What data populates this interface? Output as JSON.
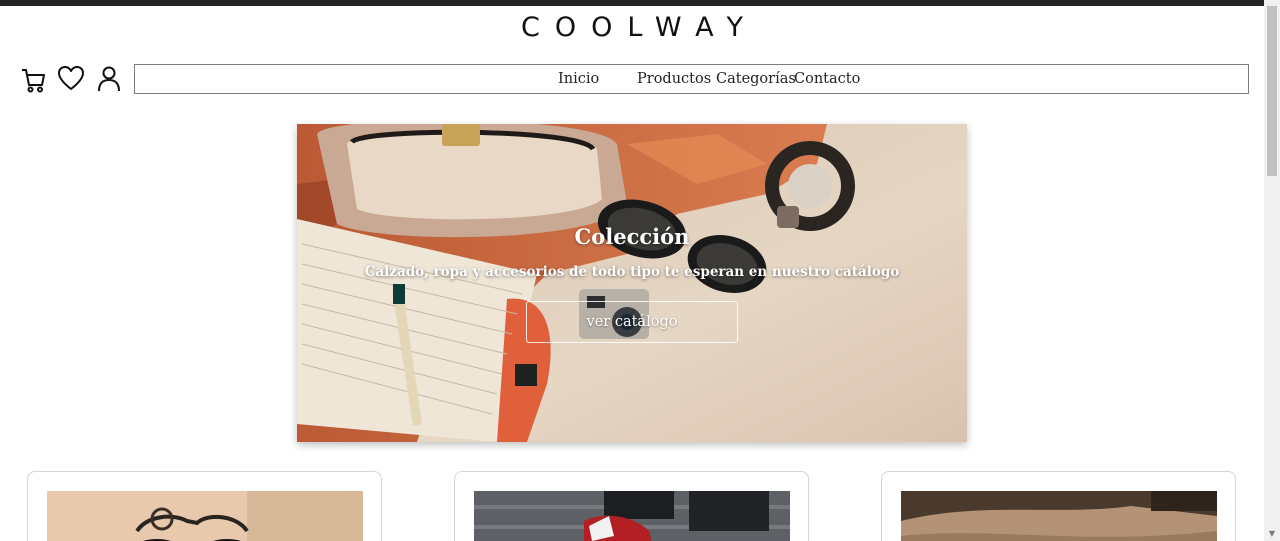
{
  "brand": {
    "name": "COOLWAY"
  },
  "header": {
    "icons": [
      "cart-icon",
      "heart-icon",
      "user-icon"
    ]
  },
  "nav": {
    "items": [
      {
        "label": "Inicio"
      },
      {
        "label": "Productos"
      },
      {
        "label": "Categorías"
      },
      {
        "label": "Contacto"
      }
    ]
  },
  "hero": {
    "title": "Colección",
    "subtitle": "Calzado, ropa y accesorios de todo tipo te esperan en nuestro catálogo",
    "button_label": "ver catálogo"
  },
  "products": {
    "cards": [
      {
        "image": "product-image-glasses"
      },
      {
        "image": "product-image-sneakers"
      },
      {
        "image": "product-image-leather"
      }
    ]
  }
}
